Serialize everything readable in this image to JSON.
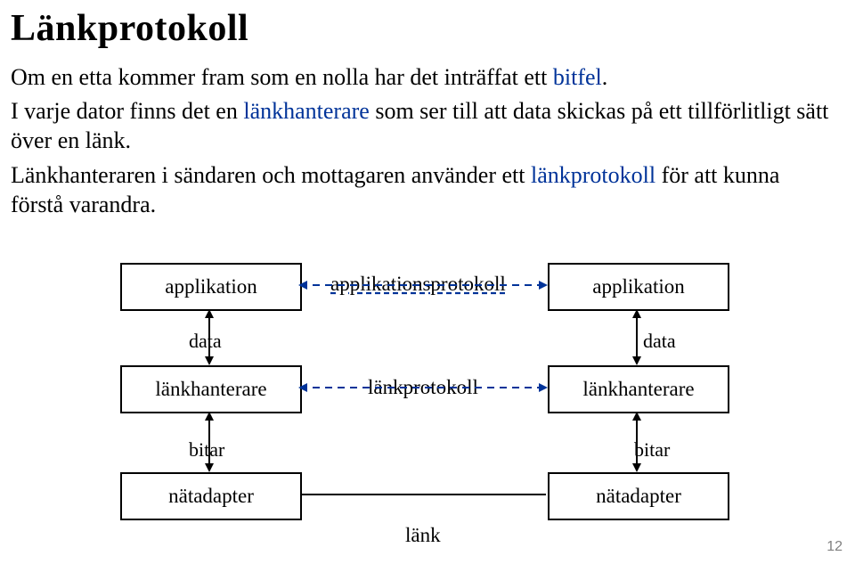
{
  "title": "Länkprotokoll",
  "paragraphs": {
    "p1a": "Om en etta kommer fram som en nolla har det inträffat ett ",
    "p1_term": "bitfel",
    "p1b": ".",
    "p2a": "I varje dator finns det en ",
    "p2_term": "länkhanterare",
    "p2b": " som ser till att data skickas på ett tillförlitligt sätt över en länk.",
    "p3a": "Länkhanteraren i sändaren och mottagaren använder ett ",
    "p3_term": "länkprotokoll",
    "p3b": " för att kunna förstå varandra."
  },
  "diagram": {
    "left": {
      "app": "applikation",
      "handler": "länkhanterare",
      "adapter": "nätadapter"
    },
    "right": {
      "app": "applikation",
      "handler": "länkhanterare",
      "adapter": "nätadapter"
    },
    "labels": {
      "appProtocol": "applikationsprotokoll",
      "linkProtocol": "länkprotokoll",
      "link": "länk",
      "dataLeft": "data",
      "dataRight": "data",
      "bitsLeft": "bitar",
      "bitsRight": "bitar"
    }
  },
  "pageNumber": "12"
}
